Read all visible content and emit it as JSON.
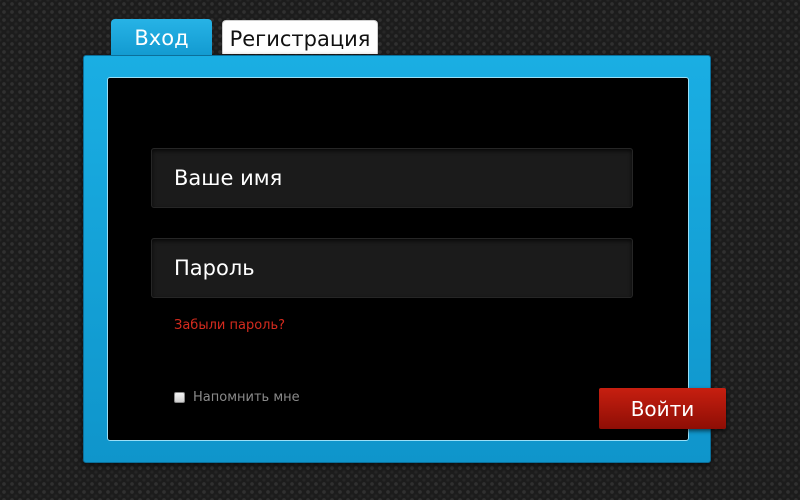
{
  "tabs": [
    {
      "label": "Вход",
      "active": true
    },
    {
      "label": "Регистрация",
      "active": false
    }
  ],
  "form": {
    "name_placeholder": "Ваше имя",
    "password_placeholder": "Пароль",
    "name_value": "",
    "password_value": "",
    "forgot_link": "Забыли пароль?",
    "remember_label": "Напомнить мне",
    "remember_checked": false,
    "submit_label": "Войти"
  },
  "colors": {
    "accent_blue": "#1aaee3",
    "submit_red": "#b01808",
    "link_red": "#d42b1e",
    "background": "#1c1c1c"
  }
}
